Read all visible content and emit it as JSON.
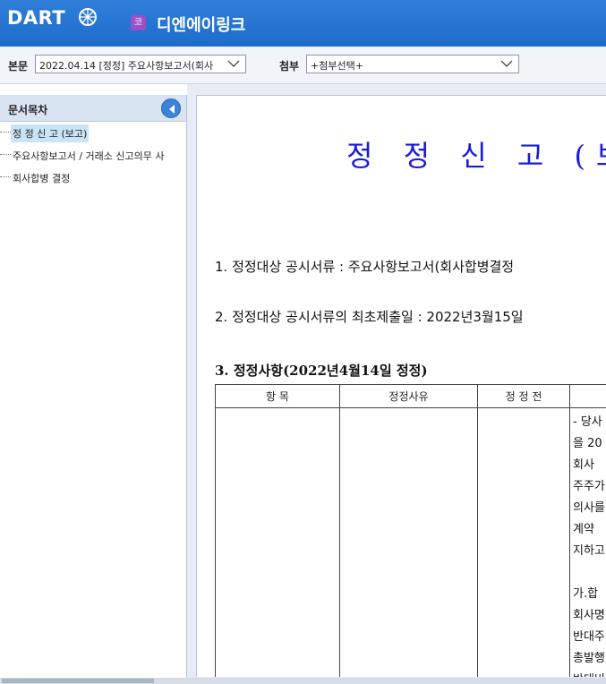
{
  "header": {
    "logo_text": "DART",
    "company_badge": "코",
    "company_name": "디엔에이링크"
  },
  "toolbar": {
    "body_label": "본문",
    "body_select_value": "2022.04.14 [정정] 주요사항보고서(회사",
    "attach_label": "첨부",
    "attach_select_value": "+첨부선택+"
  },
  "sidebar": {
    "title": "문서목차",
    "items": [
      {
        "label": "정 정 신 고 (보고)"
      },
      {
        "label": "주요사항보고서 / 거래소 신고의무 사"
      },
      {
        "label": "회사합병 결정"
      }
    ]
  },
  "document": {
    "title": "정 정 신 고 (보고",
    "line1": "1. 정정대상 공시서류 : 주요사항보고서(회사합병결정",
    "line2": "2. 정정대상 공시서류의 최초제출일 : 2022년3월15일",
    "section3": "3. 정정사항(2022년4월14일 정정)",
    "table_headers": [
      "항 목",
      "정정사유",
      "정 정 전",
      ""
    ],
    "after_lines": [
      "- 당사",
      "을 20",
      "회사",
      "주주가",
      "의사를",
      "계약",
      "지하고",
      "",
      "가.합",
      "회사명",
      "반대주",
      "총발행",
      "반대비"
    ]
  },
  "colors": {
    "header_blue": "#2f7fda",
    "title_blue": "#1a1adc",
    "selection": "#c9e4f6"
  }
}
